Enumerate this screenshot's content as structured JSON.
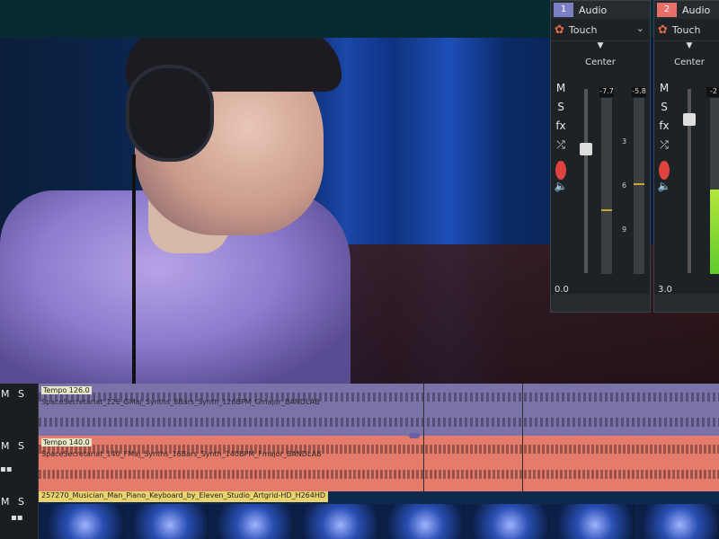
{
  "mixer": {
    "strips": [
      {
        "number": "1",
        "label": "Audio",
        "mode": "Touch",
        "pan": "Center",
        "value": "0.0",
        "peaks": [
          "-7.7",
          "-5.8"
        ],
        "scale": [
          "3",
          "6",
          "9"
        ],
        "buttons": [
          "M",
          "S",
          "fx"
        ]
      },
      {
        "number": "2",
        "label": "Audio",
        "mode": "Touch",
        "pan": "Center",
        "value": "3.0",
        "peaks": [
          "-2"
        ],
        "buttons": [
          "M",
          "S",
          "fx"
        ]
      }
    ]
  },
  "timeline": {
    "tracks": [
      {
        "mute": "M",
        "solo": "S",
        "tag": "Tempo 126.0",
        "clip_name": "SpaceSecretariat_126_GMaj_Synths_8Bars_Synth_126BPM_Gmajor_BANDLAB",
        "color": "#7a73a8"
      },
      {
        "mute": "M",
        "solo": "S",
        "tag": "Tempo 140.0",
        "clip_name": "SpaceSecretariat_140_FMaj_Synths_16Bars_Synth_140BPM_Fmajor_BANDLAB",
        "color": "#e57b6a"
      },
      {
        "mute": "M",
        "solo": "S",
        "clip_name": "257270_Musician_Man_Piano_Keyboard_by_Eleven_Studio_Artgrid-HD_H264HD",
        "color": "#0d2a4c"
      }
    ]
  }
}
